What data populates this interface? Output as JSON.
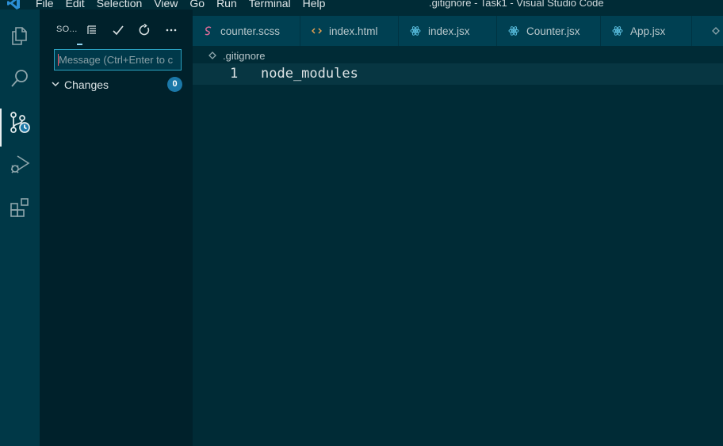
{
  "menu": [
    "File",
    "Edit",
    "Selection",
    "View",
    "Go",
    "Run",
    "Terminal",
    "Help"
  ],
  "window_title": ".gitignore - Task1 - Visual Studio Code",
  "activity_bar": [
    {
      "name": "explorer-icon"
    },
    {
      "name": "search-icon"
    },
    {
      "name": "source-control-icon",
      "active": true
    },
    {
      "name": "run-debug-icon"
    },
    {
      "name": "extensions-icon"
    }
  ],
  "sidebar": {
    "title": "SO...",
    "commit_placeholder": "Message (Ctrl+Enter to c",
    "changes_label": "Changes",
    "changes_count": "0"
  },
  "tabs": [
    {
      "label": "counter.scss",
      "icon": "scss-icon"
    },
    {
      "label": "index.html",
      "icon": "html-icon"
    },
    {
      "label": "index.jsx",
      "icon": "react-icon"
    },
    {
      "label": "Counter.jsx",
      "icon": "react-icon"
    },
    {
      "label": "App.jsx",
      "icon": "react-icon"
    }
  ],
  "breadcrumb": ".gitignore",
  "editor": {
    "lines": [
      {
        "number": "1",
        "text": "node_modules"
      }
    ]
  },
  "colors": {
    "background": "#002b36",
    "activity_bar": "#003847",
    "sidebar": "#00212b",
    "tab_bar": "#004052",
    "accent": "#2aa1c0",
    "badge": "#1b78a8",
    "react": "#55b8d8",
    "scss": "#e06c99",
    "html": "#e5a052"
  }
}
